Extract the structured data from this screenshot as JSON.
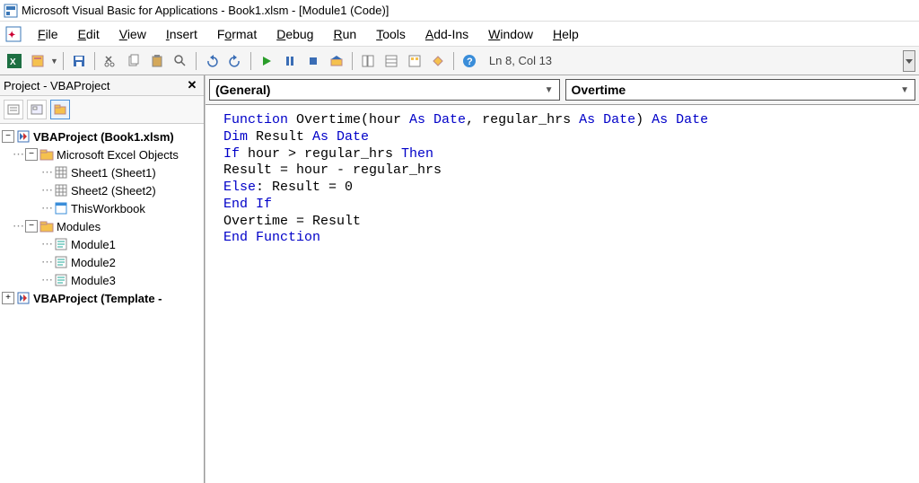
{
  "title": "Microsoft Visual Basic for Applications - Book1.xlsm - [Module1 (Code)]",
  "menu": {
    "file": "File",
    "edit": "Edit",
    "view": "View",
    "insert": "Insert",
    "format": "Format",
    "debug": "Debug",
    "run": "Run",
    "tools": "Tools",
    "addins": "Add-Ins",
    "window": "Window",
    "help": "Help"
  },
  "status": "Ln 8, Col 13",
  "project_pane": {
    "title": "Project - VBAProject",
    "tree": {
      "root1": "VBAProject (Book1.xlsm)",
      "excel_objects": "Microsoft Excel Objects",
      "sheet1": "Sheet1 (Sheet1)",
      "sheet2": "Sheet2 (Sheet2)",
      "thiswb": "ThisWorkbook",
      "modules": "Modules",
      "module1": "Module1",
      "module2": "Module2",
      "module3": "Module3",
      "root2": "VBAProject (Template -"
    }
  },
  "dropdowns": {
    "left": "(General)",
    "right": "Overtime"
  },
  "code": {
    "l1_a": "Function",
    "l1_b": " Overtime(hour ",
    "l1_c": "As Date",
    "l1_d": ", regular_hrs ",
    "l1_e": "As Date",
    "l1_f": ") ",
    "l1_g": "As Date",
    "l2_a": "Dim",
    "l2_b": " Result ",
    "l2_c": "As Date",
    "l3_a": "If",
    "l3_b": " hour > regular_hrs ",
    "l3_c": "Then",
    "l4": "Result = hour - regular_hrs",
    "l5_a": "Else",
    "l5_b": ": Result = 0",
    "l6": "End If",
    "l7": "Overtime = Result",
    "l8": "End Function"
  }
}
